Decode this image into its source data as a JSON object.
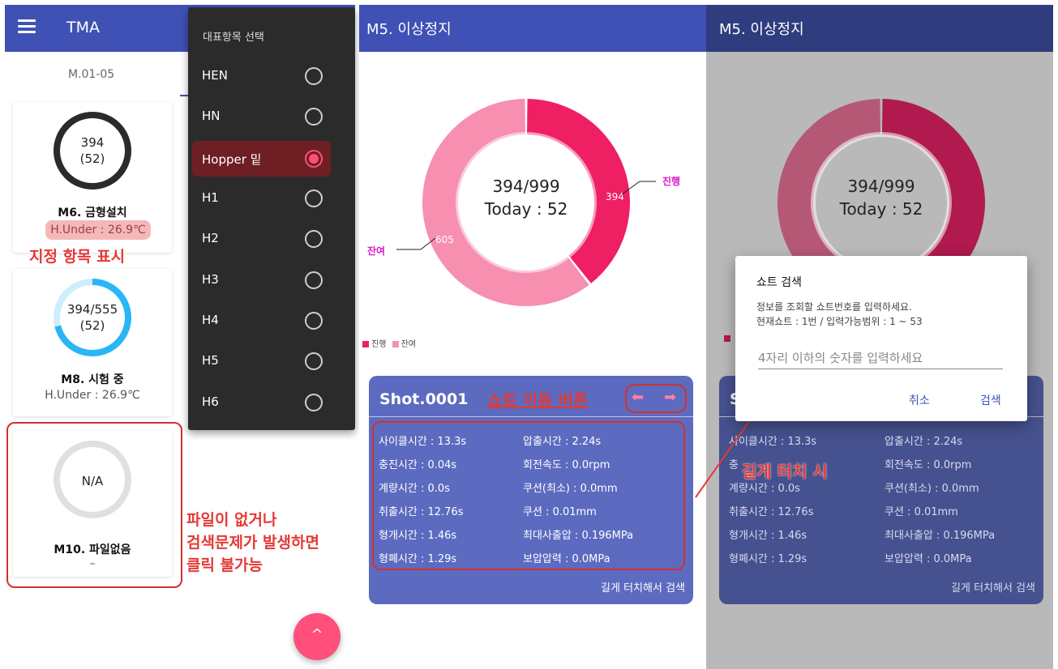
{
  "panel1": {
    "title": "TMA",
    "tab_label": "M.01-05",
    "cards": [
      {
        "ring_line1": "394",
        "ring_line2": "(52)",
        "name": "M6. 금형설치",
        "sub": "H.Under : 26.9℃",
        "ring_color": "#2b2b2b",
        "progress": 1.0
      },
      {
        "ring_line1": "394/555",
        "ring_line2": "(52)",
        "name": "M8. 시험 중",
        "sub": "H.Under : 26.9℃",
        "ring_color": "#29b6f6",
        "progress": 0.71
      },
      {
        "ring_line1": "N/A",
        "ring_line2": "",
        "name": "M10. 파일없음",
        "sub": "–",
        "ring_color": "#e0e0e0",
        "progress": 1.0
      }
    ],
    "annotation_highlight": "지정 항목 표시",
    "annotation_no_file": [
      "파일이 없거나",
      "검색문제가 발생하면",
      "클릭 불가능"
    ],
    "dropdown": {
      "title": "대표항목 선택",
      "items": [
        "HEN",
        "HN",
        "Hopper 밑",
        "H1",
        "H2",
        "H3",
        "H4",
        "H5",
        "H6"
      ],
      "selected": "Hopper 밑"
    },
    "fab_icon": "chevron-up-icon"
  },
  "panel2": {
    "title": "M5. 이상정지",
    "center_line1": "394/999",
    "center_line2": "Today : 52",
    "slice_label_progress": "394",
    "slice_label_remaining": "605",
    "callout_progress": "진행",
    "callout_remaining": "잔여",
    "legend": [
      "진행",
      "잔여"
    ],
    "shot_title": "Shot.0001",
    "shot_nav_annotation": "쇼트 이동 버튼",
    "rows": [
      [
        "사이클시간 : 13.3s",
        "압출시간 : 2.24s"
      ],
      [
        "충진시간 : 0.04s",
        "회전속도 : 0.0rpm"
      ],
      [
        "계량시간 : 0.0s",
        "쿠션(최소) : 0.0mm"
      ],
      [
        "취출시간 : 12.76s",
        "쿠션 : 0.01mm"
      ],
      [
        "형개시간 : 1.46s",
        "최대사출압 : 0.196MPa"
      ],
      [
        "형폐시간 : 1.29s",
        "보압압력 : 0.0MPa"
      ]
    ],
    "footer": "길게 터치해서 검색"
  },
  "chart_data": {
    "type": "pie",
    "categories": [
      "진행",
      "잔여"
    ],
    "values": [
      394,
      605
    ],
    "total": 999,
    "colors": [
      "#ef1f63",
      "#f78fb0"
    ]
  },
  "panel3": {
    "title": "M5. 이상정지",
    "center_line1": "394/999",
    "center_line2": "Today : 52",
    "shot_title": "S",
    "long_touch_annotation": "길게 터치 시",
    "rows": [
      [
        "사이클시간 : 13.3s",
        "압출시간 : 2.24s"
      ],
      [
        "충",
        "회전속도 : 0.0rpm"
      ],
      [
        "계량시간 : 0.0s",
        "쿠션(최소) : 0.0mm"
      ],
      [
        "취출시간 : 12.76s",
        "쿠션 : 0.01mm"
      ],
      [
        "형개시간 : 1.46s",
        "최대사출압 : 0.196MPa"
      ],
      [
        "형폐시간 : 1.29s",
        "보압압력 : 0.0MPa"
      ]
    ],
    "footer": "길게 터치해서 검색",
    "dialog": {
      "title": "쇼트 검색",
      "message1": "정보를 조회할 쇼트번호를 입력하세요.",
      "message2": "현재쇼트 : 1번 / 입력가능범위 : 1 ~ 53",
      "placeholder": "4자리 이하의 숫자를 입력하세요",
      "cancel": "취소",
      "search": "검색"
    }
  },
  "colors": {
    "primary": "#3f51b5",
    "accent": "#ff4f7a",
    "annotation_red": "#e53935",
    "shot_card": "#5c6bc0"
  }
}
